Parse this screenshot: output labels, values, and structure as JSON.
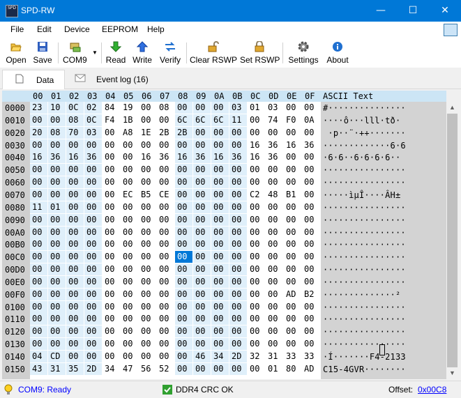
{
  "window": {
    "title": "SPD-RW",
    "app_icon_text": "SPD",
    "minimize": "—",
    "maximize": "☐",
    "close": "✕"
  },
  "menu": {
    "items": [
      "File",
      "Edit",
      "Device",
      "EEPROM",
      "Help"
    ]
  },
  "toolbar": {
    "open": "Open",
    "save": "Save",
    "port": "COM9",
    "read": "Read",
    "write": "Write",
    "verify": "Verify",
    "clear_rswp": "Clear RSWP",
    "set_rswp": "Set RSWP",
    "settings": "Settings",
    "about": "About"
  },
  "tabs": {
    "data": "Data",
    "event_log": "Event log (16)"
  },
  "hex": {
    "columns": [
      "00",
      "01",
      "02",
      "03",
      "04",
      "05",
      "06",
      "07",
      "08",
      "09",
      "0A",
      "0B",
      "0C",
      "0D",
      "0E",
      "0F"
    ],
    "ascii_header": "ASCII Text",
    "selected_row": 12,
    "selected_col": 8,
    "rows": [
      {
        "addr": "0000",
        "bytes": [
          "23",
          "10",
          "0C",
          "02",
          "84",
          "19",
          "00",
          "08",
          "00",
          "00",
          "00",
          "03",
          "01",
          "03",
          "00",
          "00"
        ],
        "ascii": "#···············"
      },
      {
        "addr": "0010",
        "bytes": [
          "00",
          "00",
          "08",
          "0C",
          "F4",
          "1B",
          "00",
          "00",
          "6C",
          "6C",
          "6C",
          "11",
          "00",
          "74",
          "F0",
          "0A"
        ],
        "ascii": "····ô···lll·tð·"
      },
      {
        "addr": "0020",
        "bytes": [
          "20",
          "08",
          "70",
          "03",
          "00",
          "A8",
          "1E",
          "2B",
          "2B",
          "00",
          "00",
          "00",
          "00",
          "00",
          "00",
          "00"
        ],
        "ascii": " ·p··¨·++·······"
      },
      {
        "addr": "0030",
        "bytes": [
          "00",
          "00",
          "00",
          "00",
          "00",
          "00",
          "00",
          "00",
          "00",
          "00",
          "00",
          "00",
          "16",
          "36",
          "16",
          "36"
        ],
        "ascii": "·············6·6"
      },
      {
        "addr": "0040",
        "bytes": [
          "16",
          "36",
          "16",
          "36",
          "00",
          "00",
          "16",
          "36",
          "16",
          "36",
          "16",
          "36",
          "16",
          "36",
          "00",
          "00"
        ],
        "ascii": "·6·6··6·6·6·6··"
      },
      {
        "addr": "0050",
        "bytes": [
          "00",
          "00",
          "00",
          "00",
          "00",
          "00",
          "00",
          "00",
          "00",
          "00",
          "00",
          "00",
          "00",
          "00",
          "00",
          "00"
        ],
        "ascii": "················"
      },
      {
        "addr": "0060",
        "bytes": [
          "00",
          "00",
          "00",
          "00",
          "00",
          "00",
          "00",
          "00",
          "00",
          "00",
          "00",
          "00",
          "00",
          "00",
          "00",
          "00"
        ],
        "ascii": "················"
      },
      {
        "addr": "0070",
        "bytes": [
          "00",
          "00",
          "00",
          "00",
          "00",
          "EC",
          "B5",
          "CE",
          "00",
          "00",
          "00",
          "00",
          "C2",
          "48",
          "B1",
          "00"
        ],
        "ascii": "·····ìµÎ····ÂH±"
      },
      {
        "addr": "0080",
        "bytes": [
          "11",
          "01",
          "00",
          "00",
          "00",
          "00",
          "00",
          "00",
          "00",
          "00",
          "00",
          "00",
          "00",
          "00",
          "00",
          "00"
        ],
        "ascii": "················"
      },
      {
        "addr": "0090",
        "bytes": [
          "00",
          "00",
          "00",
          "00",
          "00",
          "00",
          "00",
          "00",
          "00",
          "00",
          "00",
          "00",
          "00",
          "00",
          "00",
          "00"
        ],
        "ascii": "················"
      },
      {
        "addr": "00A0",
        "bytes": [
          "00",
          "00",
          "00",
          "00",
          "00",
          "00",
          "00",
          "00",
          "00",
          "00",
          "00",
          "00",
          "00",
          "00",
          "00",
          "00"
        ],
        "ascii": "················"
      },
      {
        "addr": "00B0",
        "bytes": [
          "00",
          "00",
          "00",
          "00",
          "00",
          "00",
          "00",
          "00",
          "00",
          "00",
          "00",
          "00",
          "00",
          "00",
          "00",
          "00"
        ],
        "ascii": "················"
      },
      {
        "addr": "00C0",
        "bytes": [
          "00",
          "00",
          "00",
          "00",
          "00",
          "00",
          "00",
          "00",
          "00",
          "00",
          "00",
          "00",
          "00",
          "00",
          "00",
          "00"
        ],
        "ascii": "················"
      },
      {
        "addr": "00D0",
        "bytes": [
          "00",
          "00",
          "00",
          "00",
          "00",
          "00",
          "00",
          "00",
          "00",
          "00",
          "00",
          "00",
          "00",
          "00",
          "00",
          "00"
        ],
        "ascii": "················"
      },
      {
        "addr": "00E0",
        "bytes": [
          "00",
          "00",
          "00",
          "00",
          "00",
          "00",
          "00",
          "00",
          "00",
          "00",
          "00",
          "00",
          "00",
          "00",
          "00",
          "00"
        ],
        "ascii": "················"
      },
      {
        "addr": "00F0",
        "bytes": [
          "00",
          "00",
          "00",
          "00",
          "00",
          "00",
          "00",
          "00",
          "00",
          "00",
          "00",
          "00",
          "00",
          "00",
          "AD",
          "B2"
        ],
        "ascii": "··············­²"
      },
      {
        "addr": "0100",
        "bytes": [
          "00",
          "00",
          "00",
          "00",
          "00",
          "00",
          "00",
          "00",
          "00",
          "00",
          "00",
          "00",
          "00",
          "00",
          "00",
          "00"
        ],
        "ascii": "················"
      },
      {
        "addr": "0110",
        "bytes": [
          "00",
          "00",
          "00",
          "00",
          "00",
          "00",
          "00",
          "00",
          "00",
          "00",
          "00",
          "00",
          "00",
          "00",
          "00",
          "00"
        ],
        "ascii": "················"
      },
      {
        "addr": "0120",
        "bytes": [
          "00",
          "00",
          "00",
          "00",
          "00",
          "00",
          "00",
          "00",
          "00",
          "00",
          "00",
          "00",
          "00",
          "00",
          "00",
          "00"
        ],
        "ascii": "················"
      },
      {
        "addr": "0130",
        "bytes": [
          "00",
          "00",
          "00",
          "00",
          "00",
          "00",
          "00",
          "00",
          "00",
          "00",
          "00",
          "00",
          "00",
          "00",
          "00",
          "00"
        ],
        "ascii": "················"
      },
      {
        "addr": "0140",
        "bytes": [
          "04",
          "CD",
          "00",
          "00",
          "00",
          "00",
          "00",
          "00",
          "00",
          "46",
          "34",
          "2D",
          "32",
          "31",
          "33",
          "33"
        ],
        "ascii": "·Í·······F4-2133"
      },
      {
        "addr": "0150",
        "bytes": [
          "43",
          "31",
          "35",
          "2D",
          "34",
          "47",
          "56",
          "52",
          "00",
          "00",
          "00",
          "00",
          "00",
          "01",
          "80",
          "AD"
        ],
        "ascii": "C15-4GVR········"
      }
    ]
  },
  "status": {
    "port": "COM9: Ready",
    "crc": "DDR4 CRC OK",
    "offset_label": "Offset:",
    "offset_value": "0x00C8"
  },
  "colors": {
    "titlebar": "#0078d7",
    "highlight_band": "#dfeffa",
    "selected": "#0078d7",
    "link": "#0000ff"
  }
}
